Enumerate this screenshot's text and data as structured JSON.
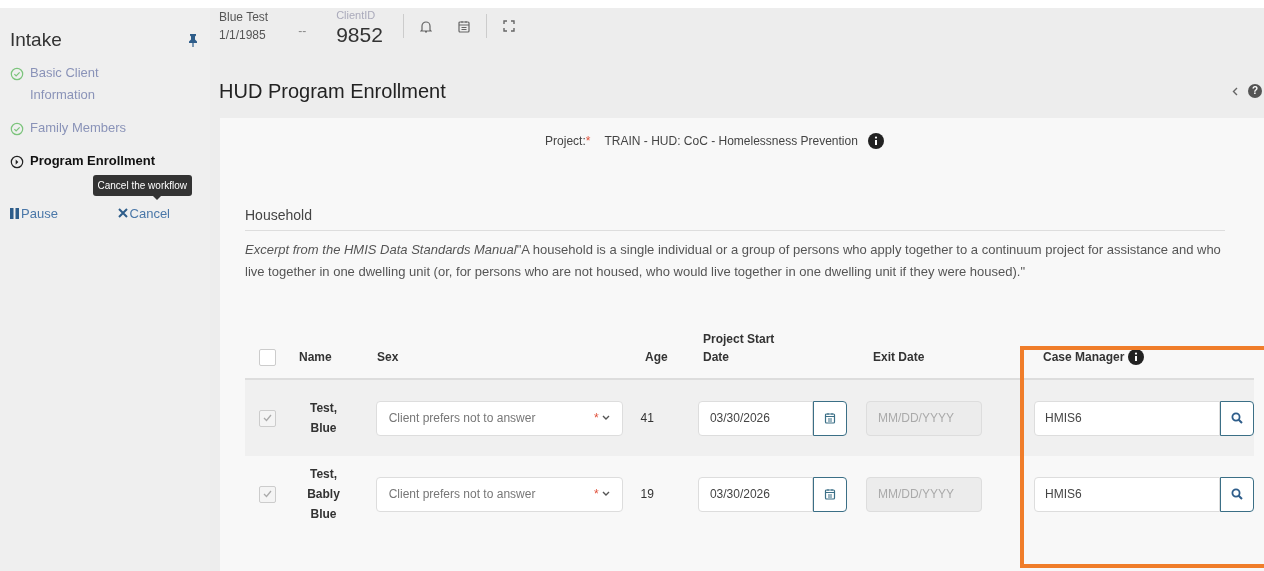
{
  "sidebar": {
    "title": "Intake",
    "pinned": true,
    "steps": [
      {
        "label": "Basic Client Information",
        "completed": true
      },
      {
        "label": "Family Members",
        "completed": true
      },
      {
        "label": "Program Enrollment",
        "completed": false
      }
    ],
    "tooltip": "Cancel the workflow",
    "actions": [
      {
        "kind": "pause",
        "label": "Pause"
      },
      {
        "kind": "cancel",
        "label": "Cancel"
      }
    ]
  },
  "header": {
    "client_name": "Blue Test",
    "client_dob": "1/1/1985",
    "separator": "--",
    "client_id_label": "ClientID",
    "client_id": "9852"
  },
  "page_title": "HUD Program Enrollment",
  "help_icon": "?",
  "project": {
    "label": "Project:",
    "required_mark": "*",
    "value": "TRAIN - HUD: CoC - Homelessness Prevention"
  },
  "household": {
    "title": "Household",
    "source": "Excerpt from the HMIS Data Standards Manual",
    "text": "\"A household is a single individual or a group of persons who apply together to a continuum project for assistance and who live together in one dwelling unit (or, for persons who are not housed, who would live together in one dwelling unit if they were housed).\"",
    "columns": [
      "Name",
      "Sex",
      "Age",
      "Project Start Date",
      "Exit Date",
      "Case Manager"
    ],
    "all_checked": false,
    "rows": [
      {
        "checked": true,
        "name": "Test, Blue",
        "sex": "Client prefers not to answer",
        "required_mark": "*",
        "age": "41",
        "start_date": "03/30/2026",
        "exit_placeholder": "MM/DD/YYYY",
        "case_manager": "HMIS6"
      },
      {
        "checked": true,
        "name": "Test, Bably Blue",
        "sex": "Client prefers not to answer",
        "required_mark": "*",
        "age": "19",
        "start_date": "03/30/2026",
        "exit_placeholder": "MM/DD/YYYY",
        "case_manager": "HMIS6"
      }
    ],
    "highlight_case_manager": true
  }
}
